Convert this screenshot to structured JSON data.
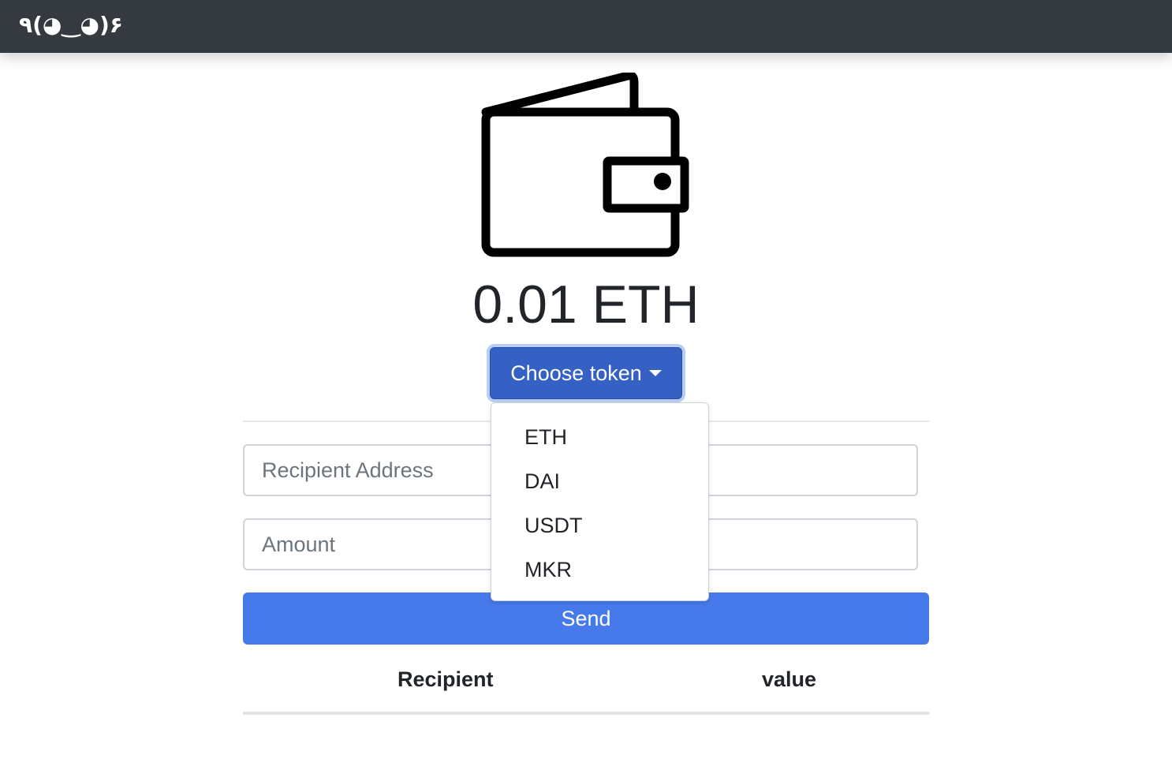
{
  "navbar": {
    "brand": "٩(◕‿◕)۶"
  },
  "wallet": {
    "icon": "wallet-icon",
    "balance": "0.01 ETH"
  },
  "token_selector": {
    "label": "Choose token",
    "options": [
      "ETH",
      "DAI",
      "USDT",
      "MKR"
    ]
  },
  "form": {
    "recipient_placeholder": "Recipient Address",
    "recipient_value": "",
    "amount_placeholder": "Amount",
    "amount_value": "",
    "send_label": "Send"
  },
  "table": {
    "headers": [
      "Recipient",
      "value"
    ],
    "rows": []
  },
  "colors": {
    "navbar": "#343a40",
    "token_button": "#3560c4",
    "send_button": "#4679ea"
  }
}
